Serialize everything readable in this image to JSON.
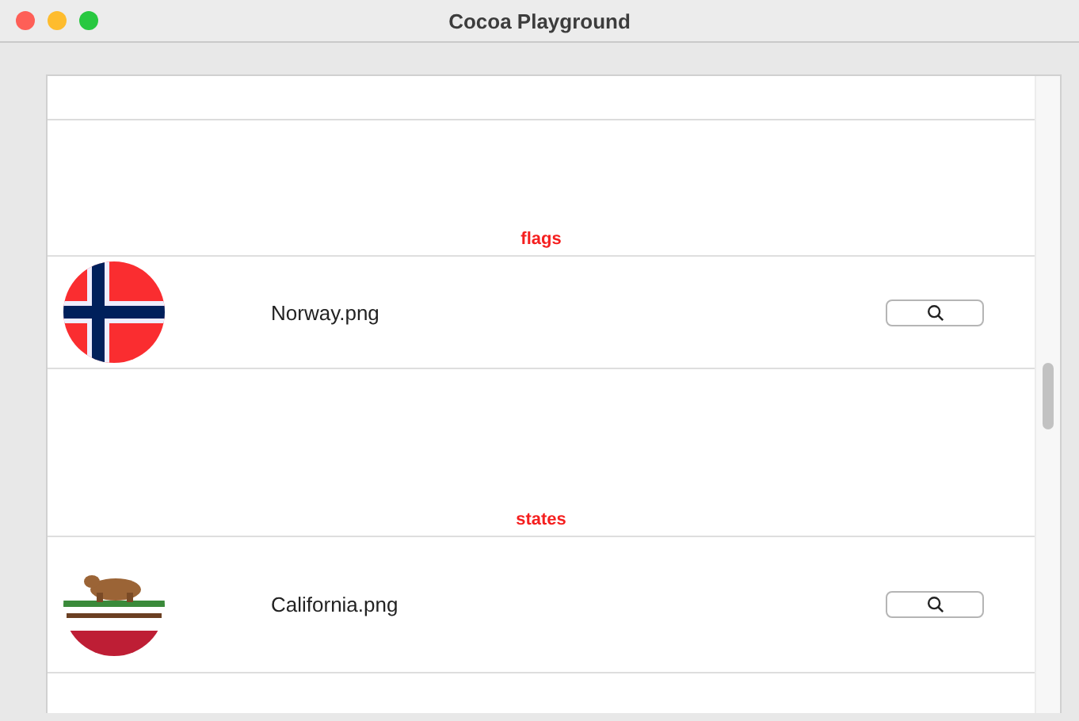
{
  "window": {
    "title": "Cocoa Playground"
  },
  "sections": [
    {
      "header": "flags",
      "rows": [
        {
          "kind": "norway",
          "filename": "Norway.png"
        }
      ]
    },
    {
      "header": "states",
      "rows": [
        {
          "kind": "california",
          "filename": "California.png"
        }
      ]
    }
  ]
}
